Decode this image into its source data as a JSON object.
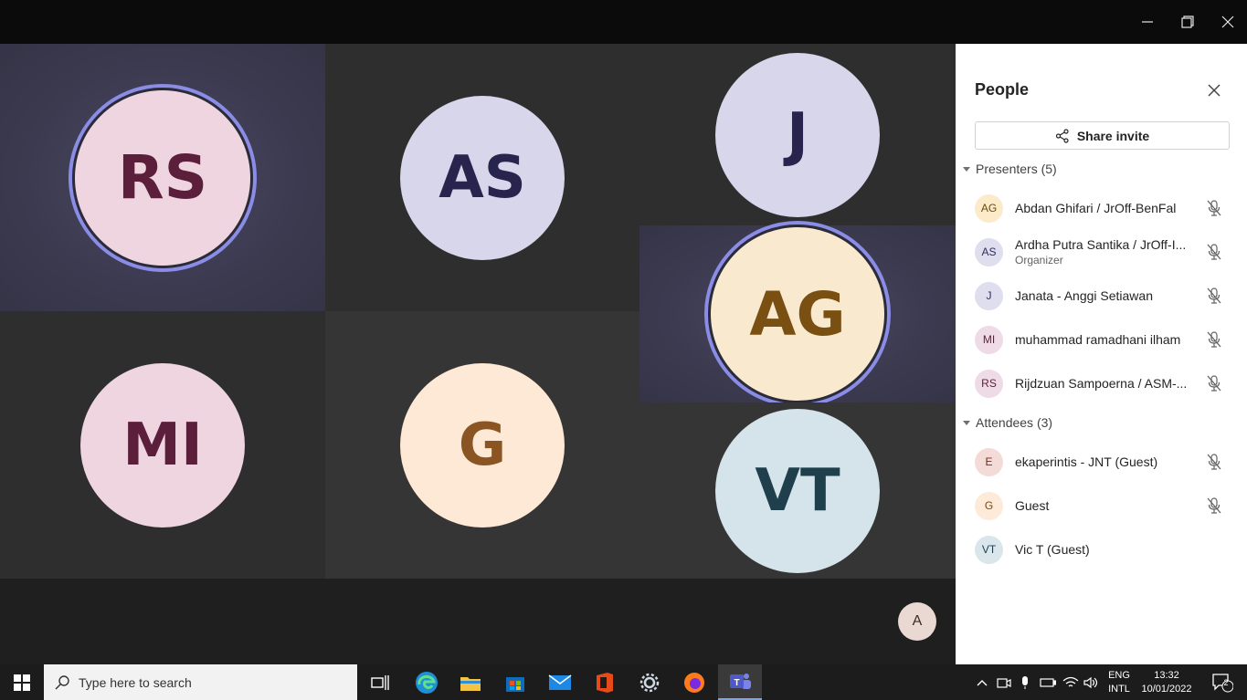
{
  "tiles": [
    {
      "initials": "RS",
      "bg": "#eed5e0",
      "fg": "#5c1f3b",
      "speaking": true
    },
    {
      "initials": "AS",
      "bg": "#d8d6ea",
      "fg": "#27254d",
      "speaking": false
    },
    {
      "initials": "J",
      "bg": "#d8d6ea",
      "fg": "#27254d",
      "speaking": false
    },
    {
      "initials": "AG",
      "bg": "#f8e9cf",
      "fg": "#7a4f12",
      "speaking": true
    },
    {
      "initials": "MI",
      "bg": "#eed5e0",
      "fg": "#5c1f3b",
      "speaking": false
    },
    {
      "initials": "G",
      "bg": "#fde9d5",
      "fg": "#8a5523",
      "speaking": false
    },
    {
      "initials": "VT",
      "bg": "#d5e3ea",
      "fg": "#1f3f4c",
      "speaking": false
    }
  ],
  "self_avatar": "A",
  "panel": {
    "title": "People",
    "share_label": "Share invite",
    "presenters_label": "Presenters (5)",
    "attendees_label": "Attendees (3)",
    "presenters": [
      {
        "initials": "AG",
        "name": "Abdan Ghifari / JrOff-BenFal",
        "role": "",
        "bg": "#fcebc8",
        "fg": "#6b4a10",
        "muted": true
      },
      {
        "initials": "AS",
        "name": "Ardha Putra Santika / JrOff-I...",
        "role": "Organizer",
        "bg": "#dfdeee",
        "fg": "#302d5a",
        "muted": true
      },
      {
        "initials": "J",
        "name": "Janata - Anggi Setiawan",
        "role": "",
        "bg": "#dfdeee",
        "fg": "#302d5a",
        "muted": true
      },
      {
        "initials": "MI",
        "name": "muhammad ramadhani ilham",
        "role": "",
        "bg": "#efdbe6",
        "fg": "#5c1f3b",
        "muted": true
      },
      {
        "initials": "RS",
        "name": "Rijdzuan Sampoerna / ASM-...",
        "role": "",
        "bg": "#efdbe6",
        "fg": "#5c1f3b",
        "muted": true
      }
    ],
    "attendees": [
      {
        "initials": "E",
        "name": "ekaperintis - JNT (Guest)",
        "role": "",
        "bg": "#f4dbd7",
        "fg": "#7a2a1e",
        "muted": true
      },
      {
        "initials": "G",
        "name": "Guest",
        "role": "",
        "bg": "#fdead8",
        "fg": "#7a4a14",
        "muted": true
      },
      {
        "initials": "VT",
        "name": "Vic T (Guest)",
        "role": "",
        "bg": "#d9e6ec",
        "fg": "#1f3f4c",
        "muted": false
      }
    ]
  },
  "taskbar": {
    "search_placeholder": "Type here to search",
    "lang_top": "ENG",
    "lang_bottom": "INTL",
    "time": "13:32",
    "date": "10/01/2022",
    "notif_count": "2"
  }
}
